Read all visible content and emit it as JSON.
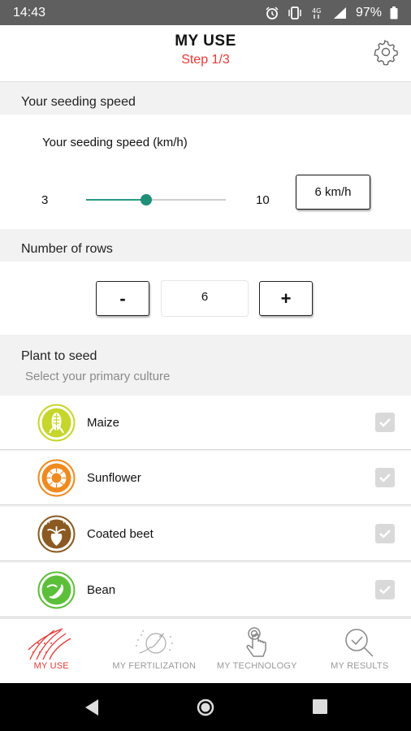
{
  "status_bar": {
    "time": "14:43",
    "battery": "97%",
    "icons": [
      "alarm-icon",
      "vibrate-icon",
      "4g-icon",
      "signal-icon",
      "battery-icon"
    ]
  },
  "header": {
    "title": "MY USE",
    "step": "Step 1/3",
    "settings_icon": "gear-icon"
  },
  "speed": {
    "section_title": "Your seeding speed",
    "label": "Your seeding speed (km/h)",
    "min": "3",
    "max": "10",
    "value_display": "6 km/h",
    "value": 6,
    "range": [
      3,
      10
    ]
  },
  "rows": {
    "section_title": "Number of rows",
    "minus_label": "-",
    "plus_label": "+",
    "value": "6"
  },
  "plants": {
    "section_title": "Plant to seed",
    "subtitle": "Select your primary culture",
    "items": [
      {
        "name": "Maize",
        "icon": "maize-icon",
        "color": "#c6d62a",
        "checked": true
      },
      {
        "name": "Sunflower",
        "icon": "sunflower-icon",
        "color": "#ef8a1e",
        "checked": true
      },
      {
        "name": "Coated beet",
        "icon": "beet-icon",
        "color": "#8a5a22",
        "checked": true
      },
      {
        "name": "Bean",
        "icon": "bean-icon",
        "color": "#5cbf3a",
        "checked": true
      }
    ]
  },
  "tabs": [
    {
      "label": "MY USE",
      "icon": "field-rows-icon",
      "active": true
    },
    {
      "label": "MY FERTILIZATION",
      "icon": "fertilizer-spread-icon",
      "active": false
    },
    {
      "label": "MY TECHNOLOGY",
      "icon": "touch-hand-icon",
      "active": false
    },
    {
      "label": "MY RESULTS",
      "icon": "magnifier-check-icon",
      "active": false
    }
  ],
  "colors": {
    "accent": "#e53935",
    "slider": "#1f8f78"
  }
}
